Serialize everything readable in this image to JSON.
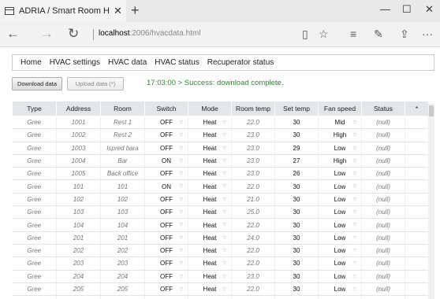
{
  "browser": {
    "tab_title": "ADRIA / Smart Room H",
    "tab_close": "✕",
    "new_tab": "+",
    "url_host": "localhost",
    "url_path": ":2006/hvacdata.html",
    "window": {
      "minimize": "—",
      "maximize": "☐",
      "close": "✕"
    },
    "nav": {
      "back": "←",
      "forward": "→",
      "reload": "↻"
    },
    "tools": {
      "reading": "▯",
      "favorite": "☆",
      "hub": "≡",
      "notes": "✎",
      "share": "⇪",
      "more": "···"
    }
  },
  "menu": [
    "Home",
    "HVAC settings",
    "HVAC data",
    "HVAC status",
    "Recuperator status"
  ],
  "buttons": {
    "download": "Download data",
    "upload": "Upload data (*)"
  },
  "status_message": "17:03:00 > Success: download complete.",
  "table": {
    "headers": [
      "Type",
      "Address",
      "Room",
      "Switch",
      "Mode",
      "Room temp",
      "Set temp",
      "Fan speed",
      "Status",
      "*"
    ],
    "caret": "▽",
    "rows": [
      [
        "Gree",
        "1001",
        "Rest 1",
        "OFF",
        "Heat",
        "22.0",
        "30",
        "Mid",
        "(null)"
      ],
      [
        "Gree",
        "1002",
        "Rest 2",
        "OFF",
        "Heat",
        "23.0",
        "30",
        "High",
        "(null)"
      ],
      [
        "Gree",
        "1003",
        "Ispred bara",
        "OFF",
        "Heat",
        "23.0",
        "29",
        "Low",
        "(null)"
      ],
      [
        "Gree",
        "1004",
        "Bar",
        "ON",
        "Heat",
        "23.0",
        "27",
        "High",
        "(null)"
      ],
      [
        "Gree",
        "1005",
        "Back office",
        "OFF",
        "Heat",
        "23.0",
        "26",
        "Low",
        "(null)"
      ],
      [
        "Gree",
        "101",
        "101",
        "ON",
        "Heat",
        "22.0",
        "30",
        "Low",
        "(null)"
      ],
      [
        "Gree",
        "102",
        "102",
        "OFF",
        "Heat",
        "21.0",
        "30",
        "Low",
        "(null)"
      ],
      [
        "Gree",
        "103",
        "103",
        "OFF",
        "Heat",
        "25.0",
        "30",
        "Low",
        "(null)"
      ],
      [
        "Gree",
        "104",
        "104",
        "OFF",
        "Heat",
        "22.0",
        "30",
        "Low",
        "(null)"
      ],
      [
        "Gree",
        "201",
        "201",
        "OFF",
        "Heat",
        "24.0",
        "30",
        "Low",
        "(null)"
      ],
      [
        "Gree",
        "202",
        "202",
        "OFF",
        "Heat",
        "22.0",
        "30",
        "Low",
        "(null)"
      ],
      [
        "Gree",
        "203",
        "203",
        "OFF",
        "Heat",
        "22.0",
        "30",
        "Low",
        "(null)"
      ],
      [
        "Gree",
        "204",
        "204",
        "OFF",
        "Heat",
        "23.0",
        "30",
        "Low",
        "(null)"
      ],
      [
        "Gree",
        "205",
        "205",
        "OFF",
        "Heat",
        "22.0",
        "30",
        "Low",
        "(null)"
      ],
      [
        "Gree",
        "206",
        "206",
        "OFF",
        "Heat",
        "22.0",
        "30",
        "Low",
        "(null)"
      ]
    ]
  }
}
